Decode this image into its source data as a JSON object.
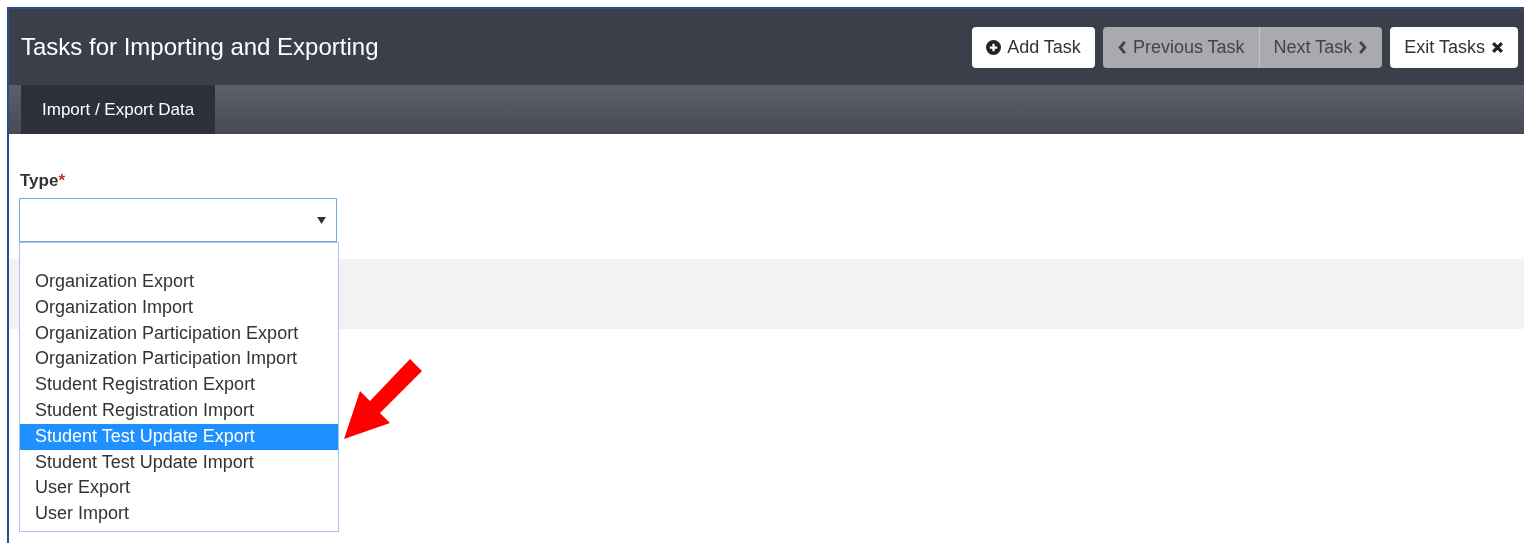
{
  "header": {
    "title": "Tasks for Importing and Exporting"
  },
  "buttons": [
    {
      "label": "Add Task",
      "kind": "add",
      "disabled": false
    },
    {
      "label": "Previous Task",
      "kind": "previous",
      "disabled": true
    },
    {
      "label": "Next Task",
      "kind": "next",
      "disabled": true
    },
    {
      "label": "Exit Tasks",
      "kind": "exit",
      "disabled": false
    }
  ],
  "tabs": [
    {
      "label": "Import / Export Data",
      "selected": true
    }
  ],
  "type_field": {
    "label": "Type",
    "required": true,
    "required_mark": "*",
    "expanded": true
  },
  "options": [
    {
      "label": "Organization Export",
      "selected": false
    },
    {
      "label": "Organization Import",
      "selected": false
    },
    {
      "label": "Organization Participation Export",
      "selected": false
    },
    {
      "label": "Organization Participation Import",
      "selected": false
    },
    {
      "label": "Student Registration Export",
      "selected": false
    },
    {
      "label": "Student Registration Import",
      "selected": false
    },
    {
      "label": "Student Test Update Export",
      "selected": true
    },
    {
      "label": "Student Test Update Import",
      "selected": false
    },
    {
      "label": "User Export",
      "selected": false
    },
    {
      "label": "User Import",
      "selected": false
    }
  ]
}
